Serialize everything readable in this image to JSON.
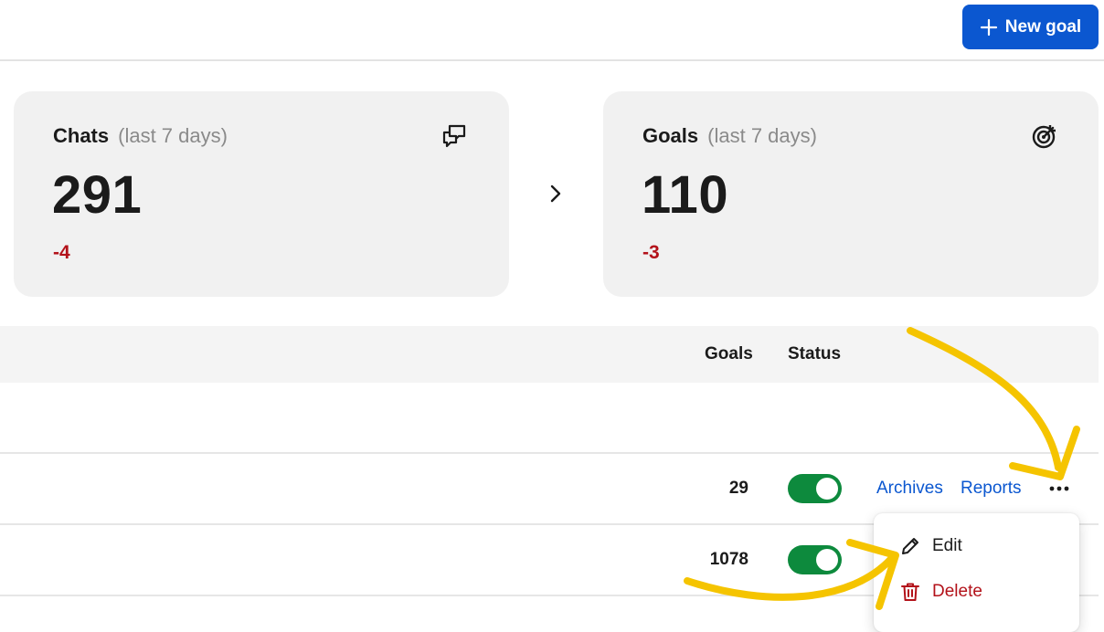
{
  "header": {
    "new_goal_label": "New goal"
  },
  "stats": {
    "chats": {
      "title": "Chats",
      "period": "(last 7 days)",
      "value": "291",
      "delta": "-4"
    },
    "goals": {
      "title": "Goals",
      "period": "(last 7 days)",
      "value": "110",
      "delta": "-3"
    }
  },
  "table": {
    "columns": {
      "goals": "Goals",
      "status": "Status"
    },
    "rows": [
      {
        "goals": "29",
        "status_on": true,
        "archives_label": "Archives",
        "reports_label": "Reports"
      },
      {
        "goals": "1078",
        "status_on": true
      }
    ]
  },
  "row_menu": {
    "edit_label": "Edit",
    "delete_label": "Delete"
  },
  "colors": {
    "primary": "#0b57d0",
    "danger": "#b3121a",
    "toggle_on": "#0d8a3d",
    "annotation": "#f5c400"
  },
  "icons": {
    "new_goal": "plus-icon",
    "chats_card": "chat-bubbles-icon",
    "goals_card": "target-icon",
    "compare": "chevron-right-icon",
    "more": "more-horizontal-icon",
    "edit": "pencil-icon",
    "delete": "trash-icon"
  }
}
